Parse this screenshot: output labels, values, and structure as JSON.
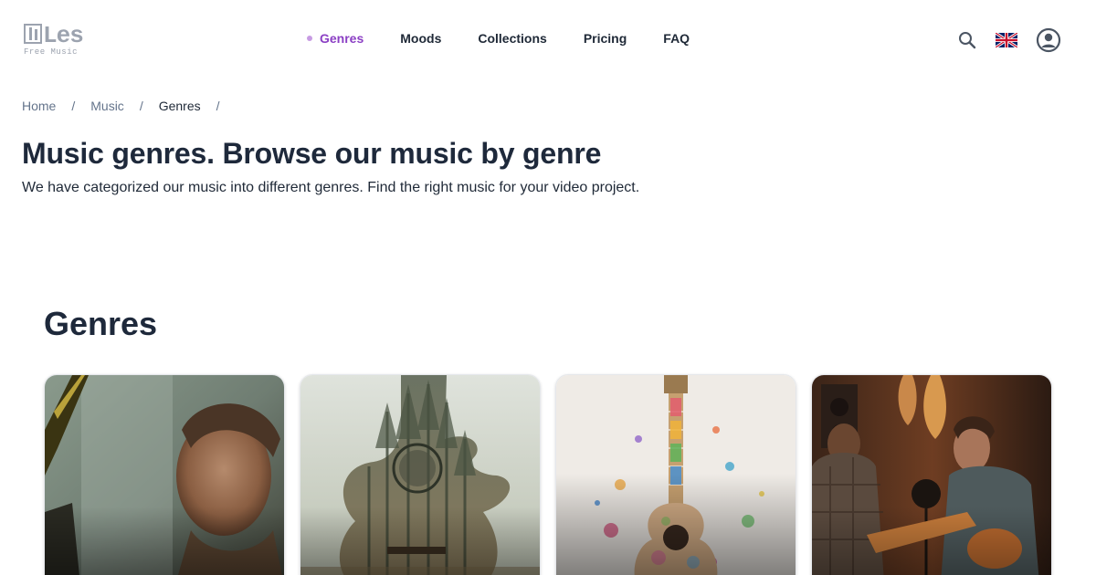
{
  "brand": {
    "name": "Les",
    "tagline": "Free Music"
  },
  "nav": {
    "items": [
      {
        "label": "Genres",
        "active": true
      },
      {
        "label": "Moods"
      },
      {
        "label": "Collections"
      },
      {
        "label": "Pricing"
      },
      {
        "label": "FAQ"
      }
    ]
  },
  "icons": {
    "search": "search-icon",
    "language": "uk-flag-icon",
    "account": "user-account-icon"
  },
  "colors": {
    "accent": "#8b3fc4",
    "accent_dot": "#c79be3",
    "text": "#1e293b",
    "muted": "#64748b"
  },
  "breadcrumb": {
    "items": [
      "Home",
      "Music",
      "Genres"
    ],
    "separator": "/"
  },
  "page": {
    "title": "Music genres. Browse our music by genre",
    "subtitle": "We have categorized our music into different genres. Find the right music for your video project."
  },
  "section": {
    "title": "Genres"
  },
  "cards": [
    {
      "image": "man-in-car-window"
    },
    {
      "image": "forest-guitar-double-exposure"
    },
    {
      "image": "watercolor-ukulele"
    },
    {
      "image": "studio-musicians-recording"
    }
  ]
}
